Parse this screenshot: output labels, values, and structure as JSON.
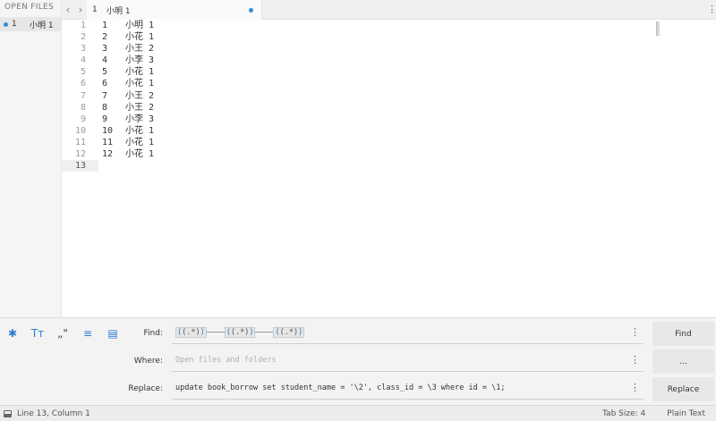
{
  "sidebar": {
    "header": "OPEN FILES",
    "file": {
      "num": "1",
      "name": "小明 1"
    }
  },
  "tabbar": {
    "back": "‹",
    "forward": "›",
    "tab": {
      "num": "1",
      "name": "小明 1"
    },
    "menu": "⋮"
  },
  "editor": {
    "gutter": [
      "1",
      "2",
      "3",
      "4",
      "5",
      "6",
      "7",
      "8",
      "9",
      "10",
      "11",
      "12",
      "13"
    ],
    "active_line": 13,
    "lines": [
      {
        "c1": "1",
        "c2": "小明 1"
      },
      {
        "c1": "2",
        "c2": "小花 1"
      },
      {
        "c1": "3",
        "c2": "小王 2"
      },
      {
        "c1": "4",
        "c2": "小李 3"
      },
      {
        "c1": "5",
        "c2": "小花 1"
      },
      {
        "c1": "6",
        "c2": "小花 1"
      },
      {
        "c1": "7",
        "c2": "小王 2"
      },
      {
        "c1": "8",
        "c2": "小王 2"
      },
      {
        "c1": "9",
        "c2": "小李 3"
      },
      {
        "c1": "10",
        "c2": "小花 1"
      },
      {
        "c1": "11",
        "c2": "小花 1"
      },
      {
        "c1": "12",
        "c2": "小花 1"
      },
      {
        "c1": "",
        "c2": ""
      }
    ]
  },
  "find": {
    "options": {
      "regex": "✱",
      "case": "Tт",
      "whole_word": "„\"",
      "wrap": "≡",
      "in_selection": "▤"
    },
    "find_label": "Find:",
    "where_label": "Where:",
    "replace_label": "Replace:",
    "find_tokens": [
      "(.*)",
      "(.*)",
      "(.*)"
    ],
    "where_placeholder": "Open files and folders",
    "replace_value": "update book_borrow set student_name = '\\2', class_id = \\3 where id = \\1;",
    "field_menu": "⋮",
    "buttons": {
      "find": "Find",
      "where": "...",
      "replace": "Replace"
    }
  },
  "status": {
    "position": "Line 13, Column 1",
    "tab_size": "Tab Size: 4",
    "syntax": "Plain Text"
  },
  "colors": {
    "accent": "#2b7cd3",
    "dirty_dot": "#2b90d9"
  }
}
